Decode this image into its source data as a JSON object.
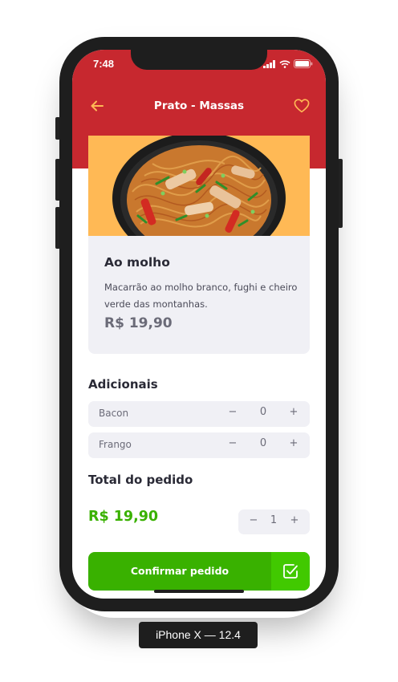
{
  "status": {
    "time": "7:48"
  },
  "nav": {
    "title": "Prato - Massas"
  },
  "dish": {
    "name": "Ao molho",
    "description": "Macarrão ao molho branco, fughi e cheiro verde das montanhas.",
    "price": "R$ 19,90"
  },
  "extras": {
    "title": "Adicionais",
    "items": [
      {
        "name": "Bacon",
        "minus": "−",
        "qty": "0",
        "plus": "+"
      },
      {
        "name": "Frango",
        "minus": "−",
        "qty": "0",
        "plus": "+"
      }
    ]
  },
  "order": {
    "title": "Total do pedido",
    "total": "R$ 19,90",
    "minus": "−",
    "qty": "1",
    "plus": "+"
  },
  "confirm": {
    "label": "Confirmar pedido",
    "icon": "check-square-icon"
  },
  "device": {
    "label": "iPhone X — 12.4"
  },
  "colors": {
    "header": "#c7282f",
    "accent_icon": "#ffb955",
    "green": "#39b100",
    "green_light": "#41c900",
    "card_bg": "#f0f0f5"
  },
  "icons": [
    "arrow-left-icon",
    "heart-icon",
    "wifi-icon",
    "battery-icon",
    "signal-icon",
    "check-square-icon"
  ]
}
